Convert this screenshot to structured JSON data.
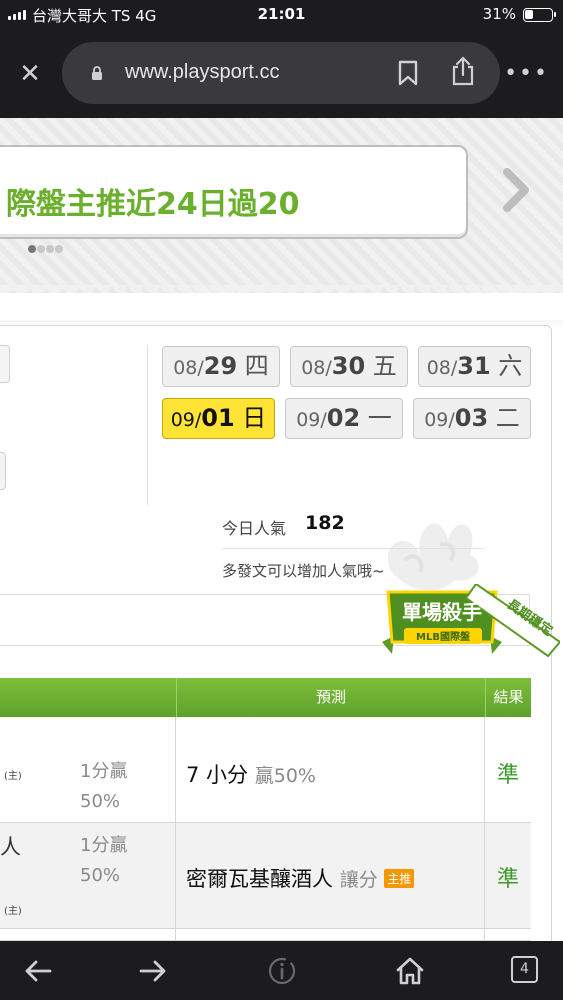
{
  "status_bar": {
    "carrier": "台灣大哥大 TS   4G",
    "time": "21:01",
    "battery": "31%",
    "battery_level": 0.31
  },
  "browser": {
    "url": "www.playsport.cc",
    "icons": [
      "close-icon",
      "lock-icon",
      "bookmark-icon",
      "share-icon",
      "more-icon"
    ]
  },
  "banner": {
    "text": "際盤主推近24日過20",
    "slide_count": 4,
    "active_slide": 1,
    "accent_color": "#6ab02c"
  },
  "dates": [
    {
      "month": "08/",
      "day": "29",
      "weekday": " 四",
      "active": false
    },
    {
      "month": "08/",
      "day": "30",
      "weekday": " 五",
      "active": false
    },
    {
      "month": "08/",
      "day": "31",
      "weekday": " 六",
      "active": false
    },
    {
      "month": "09/",
      "day": "01",
      "weekday": " 日",
      "active": true
    },
    {
      "month": "09/",
      "day": "02",
      "weekday": " 一",
      "active": false
    },
    {
      "month": "09/",
      "day": "03",
      "weekday": " 二",
      "active": false
    }
  ],
  "popularity": {
    "label": "今日人氣",
    "value": "182",
    "hint": "多發文可以增加人氣哦~"
  },
  "badge": {
    "title": "單場殺手",
    "subtitle": "MLB國際盤",
    "ribbon": "長期穩定"
  },
  "table": {
    "headers": {
      "predict": "預測",
      "result": "結果"
    },
    "rows": [
      {
        "home_mark": "(主)",
        "left_name": "",
        "points": "1分贏",
        "pct": "50%",
        "prediction": "7 小分",
        "prediction_sub": "贏50%",
        "tag": "",
        "result": "準"
      },
      {
        "home_mark": "(主)",
        "left_name": "人",
        "points": "1分贏",
        "pct": "50%",
        "prediction": "密爾瓦基釀酒人",
        "prediction_sub": "讓分",
        "tag": "主推",
        "result": "準"
      }
    ],
    "header_color": "#6cb030",
    "result_color": "#3b9a2a"
  },
  "toolbar": {
    "tab_count": "4",
    "icons": [
      "back-icon",
      "forward-icon",
      "info-icon",
      "home-icon",
      "tabs-icon"
    ]
  }
}
